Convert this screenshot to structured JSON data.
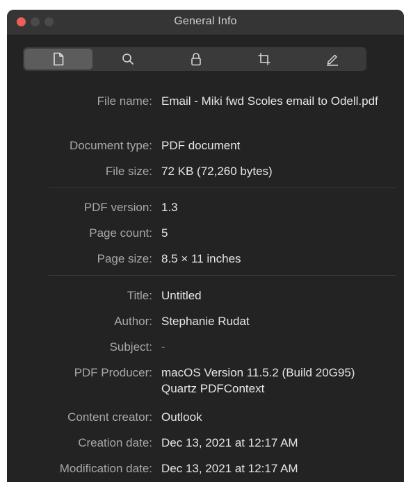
{
  "window": {
    "title": "General Info"
  },
  "toolbar": {
    "tools": [
      {
        "icon": "document-icon",
        "active": true
      },
      {
        "icon": "search-icon",
        "active": false
      },
      {
        "icon": "lock-icon",
        "active": false
      },
      {
        "icon": "crop-icon",
        "active": false
      },
      {
        "icon": "pencil-icon",
        "active": false
      }
    ]
  },
  "info": {
    "file_name": {
      "label": "File name:",
      "value": "Email - Miki fwd Scoles email to Odell.pdf"
    },
    "document_type": {
      "label": "Document type:",
      "value": "PDF document"
    },
    "file_size": {
      "label": "File size:",
      "value": "72 KB (72,260 bytes)"
    },
    "pdf_version": {
      "label": "PDF version:",
      "value": "1.3"
    },
    "page_count": {
      "label": "Page count:",
      "value": "5"
    },
    "page_size": {
      "label": "Page size:",
      "value": "8.5 × 11 inches"
    },
    "title": {
      "label": "Title:",
      "value": "Untitled"
    },
    "author": {
      "label": "Author:",
      "value": "Stephanie Rudat"
    },
    "subject": {
      "label": "Subject:",
      "value": "-"
    },
    "pdf_producer": {
      "label": "PDF Producer:",
      "value": "macOS Version 11.5.2 (Build 20G95) Quartz PDFContext"
    },
    "content_creator": {
      "label": "Content creator:",
      "value": "Outlook"
    },
    "creation_date": {
      "label": "Creation date:",
      "value": "Dec 13, 2021 at 12:17 AM"
    },
    "modification_date": {
      "label": "Modification date:",
      "value": "Dec 13, 2021 at 12:17 AM"
    }
  },
  "colors": {
    "window_bg": "#232323",
    "close_button": "#ed5e57",
    "label_text": "#a8a8a8",
    "value_text": "#e6e6e6"
  }
}
